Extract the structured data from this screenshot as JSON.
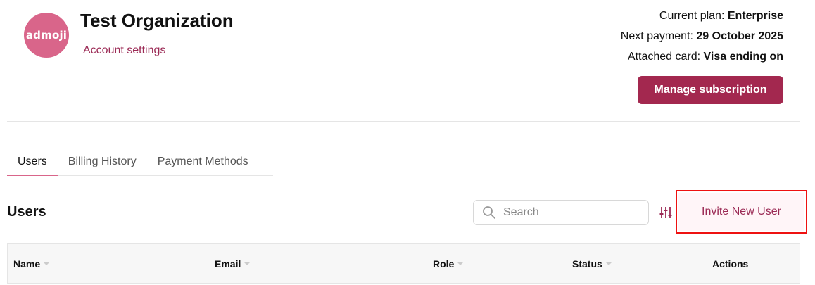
{
  "org": {
    "logo_text": "admoji",
    "title": "Test Organization",
    "account_link": "Account settings"
  },
  "plan": {
    "current_label": "Current plan:",
    "current_value": "Enterprise",
    "next_payment_label": "Next payment:",
    "next_payment_value": "29 October 2025",
    "card_label": "Attached card:",
    "card_value": "Visa ending on"
  },
  "manage_button": "Manage subscription",
  "tabs": [
    {
      "label": "Users",
      "active": true
    },
    {
      "label": "Billing History",
      "active": false
    },
    {
      "label": "Payment Methods",
      "active": false
    }
  ],
  "users_section": {
    "title": "Users",
    "search_placeholder": "Search",
    "invite_button": "Invite New User"
  },
  "table": {
    "columns": [
      "Name",
      "Email",
      "Role",
      "Status",
      "Actions"
    ]
  },
  "colors": {
    "brand": "#a3284f",
    "logo": "#d9658a",
    "highlight": "#e11"
  }
}
